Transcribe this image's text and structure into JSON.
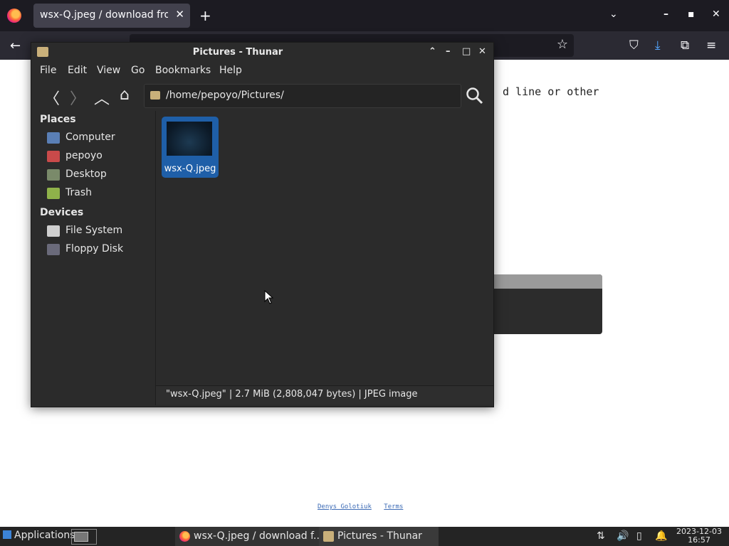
{
  "browser": {
    "tab_title": "wsx-Q.jpeg / download from",
    "tab_close": "✕",
    "new_tab": "+",
    "list_tabs": "⌄",
    "win_min": "–",
    "win_max": "▪",
    "win_close": "✕",
    "back": "←",
    "bookmark_star": "☆",
    "page_text": "d line or other",
    "footer_links": [
      "Denys Golotiuk",
      "Terms"
    ]
  },
  "thunar": {
    "title": "Pictures - Thunar",
    "win_shade": "⌃",
    "win_min": "–",
    "win_max": "□",
    "win_close": "✕",
    "menu": [
      "File",
      "Edit",
      "View",
      "Go",
      "Bookmarks",
      "Help"
    ],
    "nav": {
      "back": "〈",
      "forward": "〉",
      "up": "︿",
      "home": "⌂"
    },
    "path": "/home/pepoyo/Pictures/",
    "sidebar": {
      "places_header": "Places",
      "places": [
        {
          "label": "Computer",
          "icon": "computer-icon",
          "color": "#5a7fb5"
        },
        {
          "label": "pepoyo",
          "icon": "home-folder-icon",
          "color": "#c94a4a"
        },
        {
          "label": "Desktop",
          "icon": "desktop-icon",
          "color": "#7a8a6a"
        },
        {
          "label": "Trash",
          "icon": "trash-icon",
          "color": "#8fb24a"
        }
      ],
      "devices_header": "Devices",
      "devices": [
        {
          "label": "File System",
          "icon": "drive-icon",
          "color": "#cfcfcf"
        },
        {
          "label": "Floppy Disk",
          "icon": "floppy-icon",
          "color": "#6a6a7a"
        }
      ]
    },
    "files": [
      {
        "name": "wsx-Q.jpeg",
        "selected": true
      }
    ],
    "status": "\"wsx-Q.jpeg\"  |  2.7 MiB (2,808,047 bytes)  |  JPEG image"
  },
  "taskbar": {
    "applications": "Applications",
    "tasks": [
      {
        "label": "wsx-Q.jpeg / download f...",
        "icon": "firefox-icon"
      },
      {
        "label": "Pictures - Thunar",
        "icon": "thunar-icon"
      }
    ],
    "clock_date": "2023-12-03",
    "clock_time": "16:57"
  },
  "colors": {
    "selection": "#1f5fa8",
    "window_bg": "#2b2b2b",
    "taskbar_bg": "#242424"
  }
}
